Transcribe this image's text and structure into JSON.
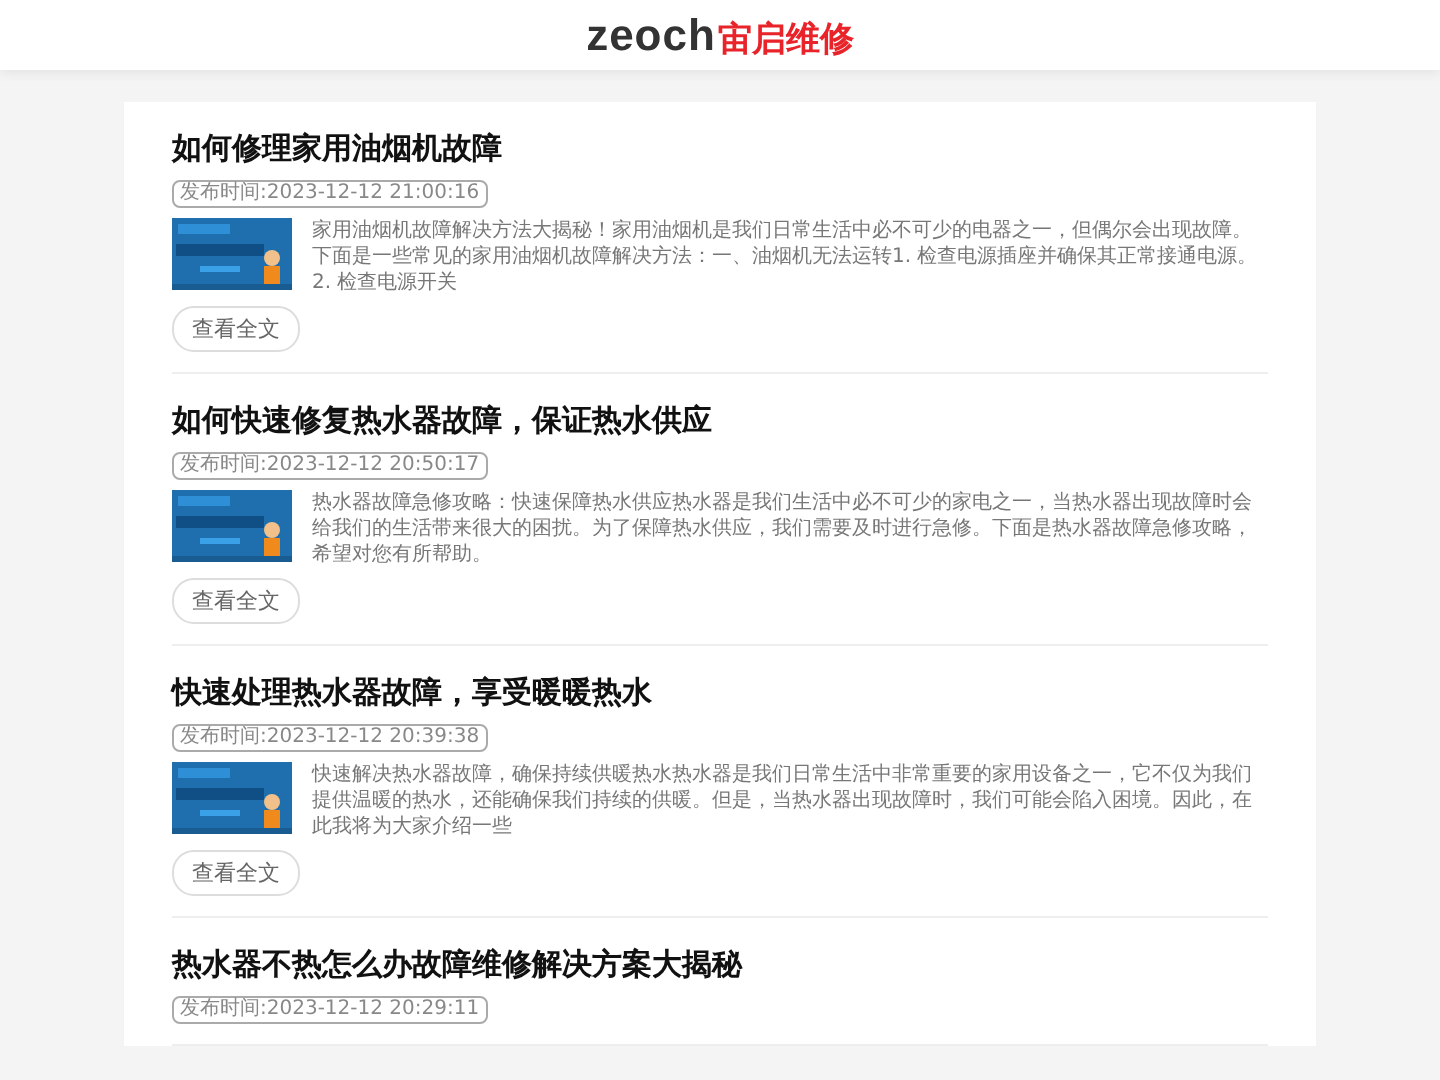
{
  "header": {
    "logo_latin": "zeoch",
    "logo_cjk": "宙启维修"
  },
  "posts": [
    {
      "title": "如何修理家用油烟机故障",
      "date": "发布时间:2023-12-12 21:00:16",
      "excerpt": "家用油烟机故障解决方法大揭秘！家用油烟机是我们日常生活中必不可少的电器之一，但偶尔会出现故障。下面是一些常见的家用油烟机故障解决方法：一、油烟机无法运转1. 检查电源插座并确保其正常接通电源。2. 检查电源开关",
      "button": "查看全文"
    },
    {
      "title": "如何快速修复热水器故障，保证热水供应",
      "date": "发布时间:2023-12-12 20:50:17",
      "excerpt": "热水器故障急修攻略：快速保障热水供应热水器是我们生活中必不可少的家电之一，当热水器出现故障时会给我们的生活带来很大的困扰。为了保障热水供应，我们需要及时进行急修。下面是热水器故障急修攻略，希望对您有所帮助。",
      "button": "查看全文"
    },
    {
      "title": "快速处理热水器故障，享受暖暖热水",
      "date": "发布时间:2023-12-12 20:39:38",
      "excerpt": "快速解决热水器故障，确保持续供暖热水热水器是我们日常生活中非常重要的家用设备之一，它不仅为我们提供温暖的热水，还能确保我们持续的供暖。但是，当热水器出现故障时，我们可能会陷入困境。因此，在此我将为大家介绍一些",
      "button": "查看全文"
    },
    {
      "title": "热水器不热怎么办故障维修解决方案大揭秘",
      "date": "发布时间:2023-12-12 20:29:11"
    }
  ]
}
